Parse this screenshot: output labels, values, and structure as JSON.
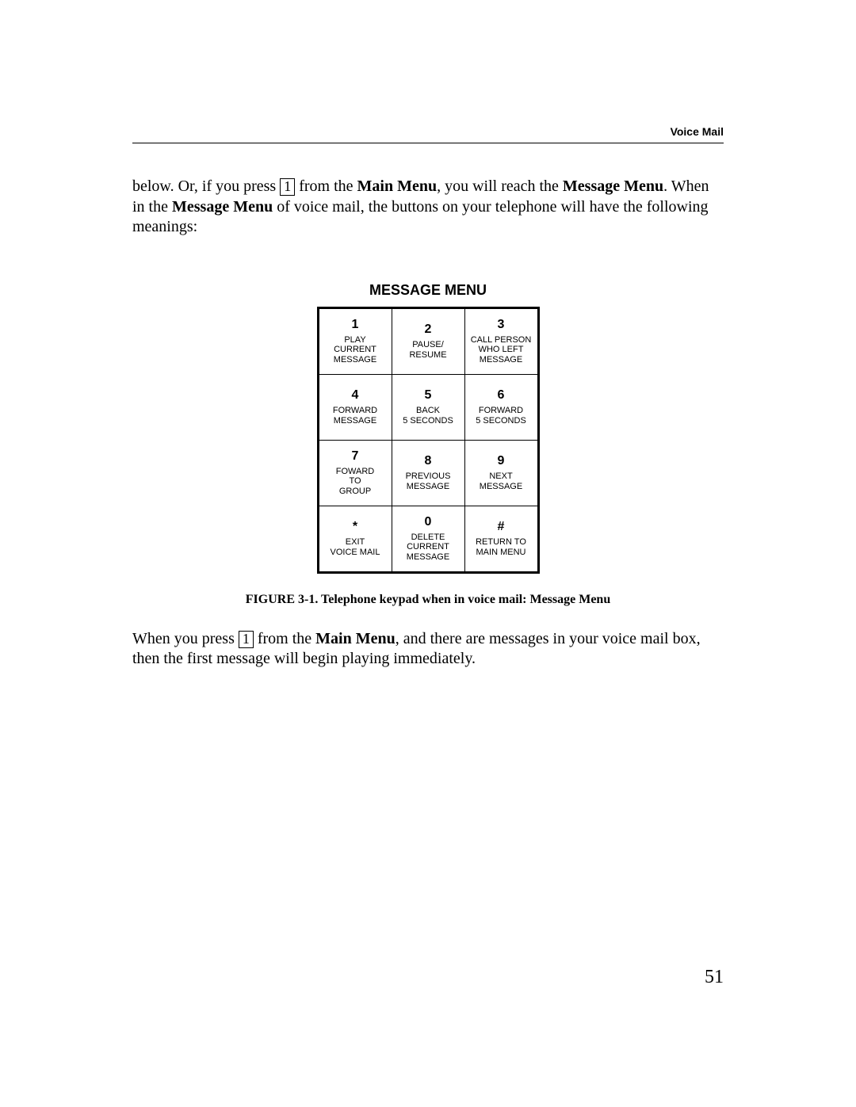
{
  "header": {
    "section": "Voice Mail"
  },
  "intro": {
    "pre": "below.  Or, if you press ",
    "key": "1",
    "mid1": " from the ",
    "b1": "Main Menu",
    "mid2": ", you will reach the ",
    "b2": "Message Menu",
    "mid3": ".  When in the ",
    "b3": "Message Menu",
    "tail": " of voice mail, the buttons on your telephone will have the following meanings:"
  },
  "menu": {
    "title": "MESSAGE MENU",
    "keys": [
      [
        {
          "num": "1",
          "label": "PLAY\nCURRENT\nMESSAGE"
        },
        {
          "num": "2",
          "label": "PAUSE/\nRESUME"
        },
        {
          "num": "3",
          "label": "CALL PERSON\nWHO LEFT\nMESSAGE"
        }
      ],
      [
        {
          "num": "4",
          "label": "FORWARD\nMESSAGE"
        },
        {
          "num": "5",
          "label": "BACK\n5 SECONDS"
        },
        {
          "num": "6",
          "label": "FORWARD\n5 SECONDS"
        }
      ],
      [
        {
          "num": "7",
          "label": "FOWARD\nTO\nGROUP"
        },
        {
          "num": "8",
          "label": "PREVIOUS\nMESSAGE"
        },
        {
          "num": "9",
          "label": "NEXT\nMESSAGE"
        }
      ],
      [
        {
          "num": "*",
          "label": "EXIT\nVOICE MAIL"
        },
        {
          "num": "0",
          "label": "DELETE\nCURRENT\nMESSAGE"
        },
        {
          "num": "#",
          "label": "RETURN TO\nMAIN MENU"
        }
      ]
    ],
    "caption": "FIGURE 3-1. Telephone keypad when in voice mail: Message Menu"
  },
  "after": {
    "pre": "When you press ",
    "key": "1",
    "mid1": " from the ",
    "b1": "Main Menu",
    "tail": ", and there are messages in your voice mail box, then the first message will begin playing immediately."
  },
  "page_number": "51"
}
